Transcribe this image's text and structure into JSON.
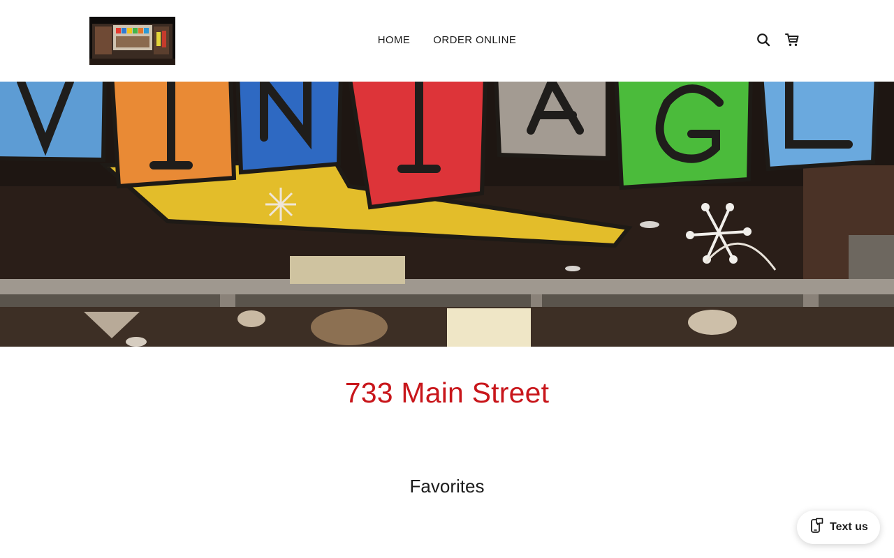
{
  "header": {
    "logo_alt": "Store front logo",
    "nav": [
      {
        "label": "HOME"
      },
      {
        "label": "ORDER ONLINE"
      }
    ],
    "icons": {
      "search": "search-icon",
      "cart": "cart-icon"
    }
  },
  "hero": {
    "letters": [
      "V",
      "I",
      "N",
      "T",
      "A",
      "G",
      "E"
    ]
  },
  "main": {
    "address": "733 Main Street",
    "section_title": "Favorites"
  },
  "chat": {
    "label": "Text us",
    "icon": "message-phone-icon"
  },
  "colors": {
    "accent": "#c8161b",
    "text": "#1b1b1b"
  }
}
